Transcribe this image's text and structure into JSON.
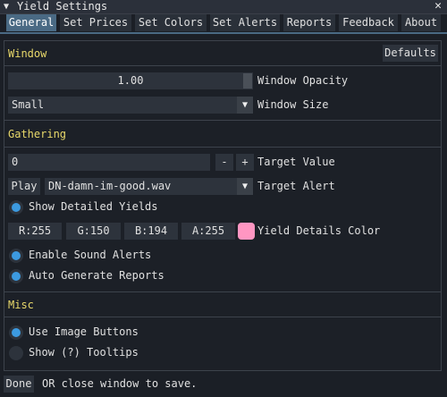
{
  "window": {
    "title": "Yield Settings",
    "close_glyph": "✕",
    "collapse_glyph": "▼"
  },
  "tabs": [
    {
      "label": "General",
      "active": true
    },
    {
      "label": "Set Prices",
      "active": false
    },
    {
      "label": "Set Colors",
      "active": false
    },
    {
      "label": "Set Alerts",
      "active": false
    },
    {
      "label": "Reports",
      "active": false
    },
    {
      "label": "Feedback",
      "active": false
    },
    {
      "label": "About",
      "active": false
    }
  ],
  "window_section": {
    "header": "Window",
    "defaults_label": "Defaults",
    "opacity": {
      "value": "1.00",
      "label": "Window Opacity"
    },
    "size": {
      "value": "Small",
      "label": "Window Size"
    }
  },
  "gathering": {
    "header": "Gathering",
    "target_value": {
      "value": "0",
      "minus": "-",
      "plus": "+",
      "label": "Target Value"
    },
    "alert": {
      "play_label": "Play",
      "value": "DN-damn-im-good.wav",
      "label": "Target Alert"
    },
    "show_detailed": {
      "label": "Show Detailed Yields",
      "checked": true
    },
    "color": {
      "r": "R:255",
      "g": "G:150",
      "b": "B:194",
      "a": "A:255",
      "label": "Yield Details Color",
      "hex": "#ff96c2"
    },
    "sound_alerts": {
      "label": "Enable Sound Alerts",
      "checked": true
    },
    "auto_reports": {
      "label": "Auto Generate Reports",
      "checked": true
    }
  },
  "misc": {
    "header": "Misc",
    "image_buttons": {
      "label": "Use Image Buttons",
      "checked": true
    },
    "tooltips": {
      "label": "Show (?) Tooltips",
      "checked": false
    }
  },
  "footer": {
    "done_label": "Done",
    "hint": "OR close window to save."
  },
  "colors": {
    "accent": "#4a6a84",
    "header_text": "#e8d86a",
    "check": "#3c9ae0"
  }
}
